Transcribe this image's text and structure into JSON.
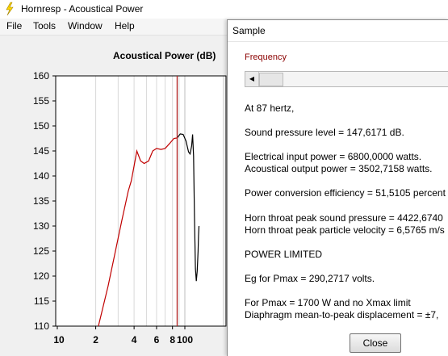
{
  "window": {
    "title": "Hornresp - Acoustical Power"
  },
  "menu": [
    "File",
    "Tools",
    "Window",
    "Help"
  ],
  "colors": {
    "response_below": "#c00000",
    "response_above": "#000000",
    "marker": "#b22222",
    "grid": "#d9d9d9"
  },
  "chart_data": {
    "type": "line",
    "title": "Acoustical Power (dB)",
    "x_scale": "log",
    "ylim": [
      110,
      160
    ],
    "yticks": [
      160,
      155,
      150,
      145,
      140,
      135,
      130,
      125,
      120,
      115,
      110
    ],
    "xtick_labels": [
      "10",
      "2",
      "4",
      "6",
      "8",
      "100"
    ],
    "xtick_values": [
      10,
      20,
      40,
      60,
      80,
      100
    ],
    "marker_x": 87,
    "series": [
      {
        "segment": "below_marker",
        "x": [
          21,
          25,
          28,
          32,
          36,
          38,
          40,
          42,
          45,
          48,
          52,
          56,
          60,
          65,
          70,
          76,
          82,
          87
        ],
        "y": [
          110,
          118,
          124,
          131,
          137,
          139,
          142,
          145,
          143,
          142.5,
          143,
          145,
          145.5,
          145.3,
          145.5,
          146.5,
          147.5,
          147.6
        ]
      },
      {
        "segment": "above_marker",
        "x": [
          87,
          92,
          97,
          102,
          107,
          110,
          113,
          115,
          117,
          119,
          121,
          123,
          125,
          127,
          128,
          129
        ],
        "y": [
          147.6,
          148.4,
          148.3,
          147,
          144.8,
          144.4,
          146,
          148.3,
          144,
          132,
          121.5,
          119,
          121,
          125,
          128,
          130
        ]
      }
    ]
  },
  "dialog": {
    "title": "Sample",
    "frequency_label": "Frequency",
    "lines": [
      "At 87 hertz,",
      "Sound pressure level = 147,6171 dB.",
      "Electrical input power = 6800,0000 watts.",
      "Acoustical output power = 3502,7158 watts.",
      "Power conversion efficiency = 51,5105 percent",
      "Horn throat peak sound pressure = 4422,6740",
      "Horn throat peak particle velocity = 6,5765 m/s",
      "POWER LIMITED",
      "Eg for Pmax = 290,2717 volts.",
      "For Pmax = 1700 W and no Xmax limit",
      "Diaphragm mean-to-peak displacement = ±7,"
    ],
    "close_label": "Close"
  }
}
